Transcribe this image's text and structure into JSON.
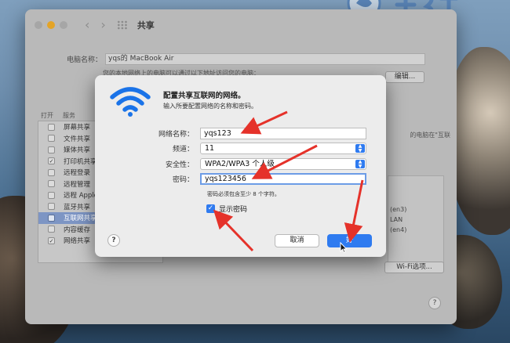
{
  "window": {
    "title": "共享",
    "computer_name_label": "电脑名称：",
    "computer_name_value": "yqs的 MacBook Air",
    "hint_text": "您的本地网络上的电脑可以通过以下地址访问您的电脑：",
    "edit_button": "编辑...",
    "services_header": {
      "on": "打开",
      "service": "服务"
    },
    "services": [
      {
        "label": "屏幕共享",
        "checked": false,
        "selected": false
      },
      {
        "label": "文件共享",
        "checked": false,
        "selected": false
      },
      {
        "label": "媒体共享",
        "checked": false,
        "selected": false
      },
      {
        "label": "打印机共享",
        "checked": true,
        "selected": false
      },
      {
        "label": "远程登录",
        "checked": false,
        "selected": false
      },
      {
        "label": "远程管理",
        "checked": false,
        "selected": false
      },
      {
        "label": "远程 Apple 事件",
        "checked": false,
        "selected": false
      },
      {
        "label": "蓝牙共享",
        "checked": false,
        "selected": false
      },
      {
        "label": "互联网共享",
        "checked": false,
        "selected": true
      },
      {
        "label": "内容缓存",
        "checked": false,
        "selected": false
      },
      {
        "label": "网络共享",
        "checked": true,
        "selected": false
      }
    ],
    "right_note": "的电脑在\"互联",
    "right_items": [
      "(en3)",
      "LAN",
      "(en4)"
    ],
    "wifi_options_button": "Wi-Fi选项...",
    "help_button": "?"
  },
  "dialog": {
    "title": "配置共享互联网的网络。",
    "subtitle": "输入所要配置网络的名称和密码。",
    "network_name_label": "网络名称：",
    "network_name_value": "yqs123",
    "channel_label": "频道：",
    "channel_value": "11",
    "security_label": "安全性：",
    "security_value": "WPA2/WPA3 个人级",
    "password_label": "密码：",
    "password_value": "yqs123456",
    "password_hint": "密码必须包含至少 8 个字符。",
    "show_password_label": "显示密码",
    "show_password_checked": true,
    "help_button": "?",
    "cancel_button": "取消",
    "ok_button": "好"
  },
  "colors": {
    "accent": "#2f7bf0",
    "annotation_arrow": "#e5322a",
    "selection": "#7d95c4"
  },
  "icons": {
    "dialog_icon": "wifi-icon",
    "select_arrows": "up-down-chevron-icon",
    "pointer": "mouse-cursor-icon"
  }
}
